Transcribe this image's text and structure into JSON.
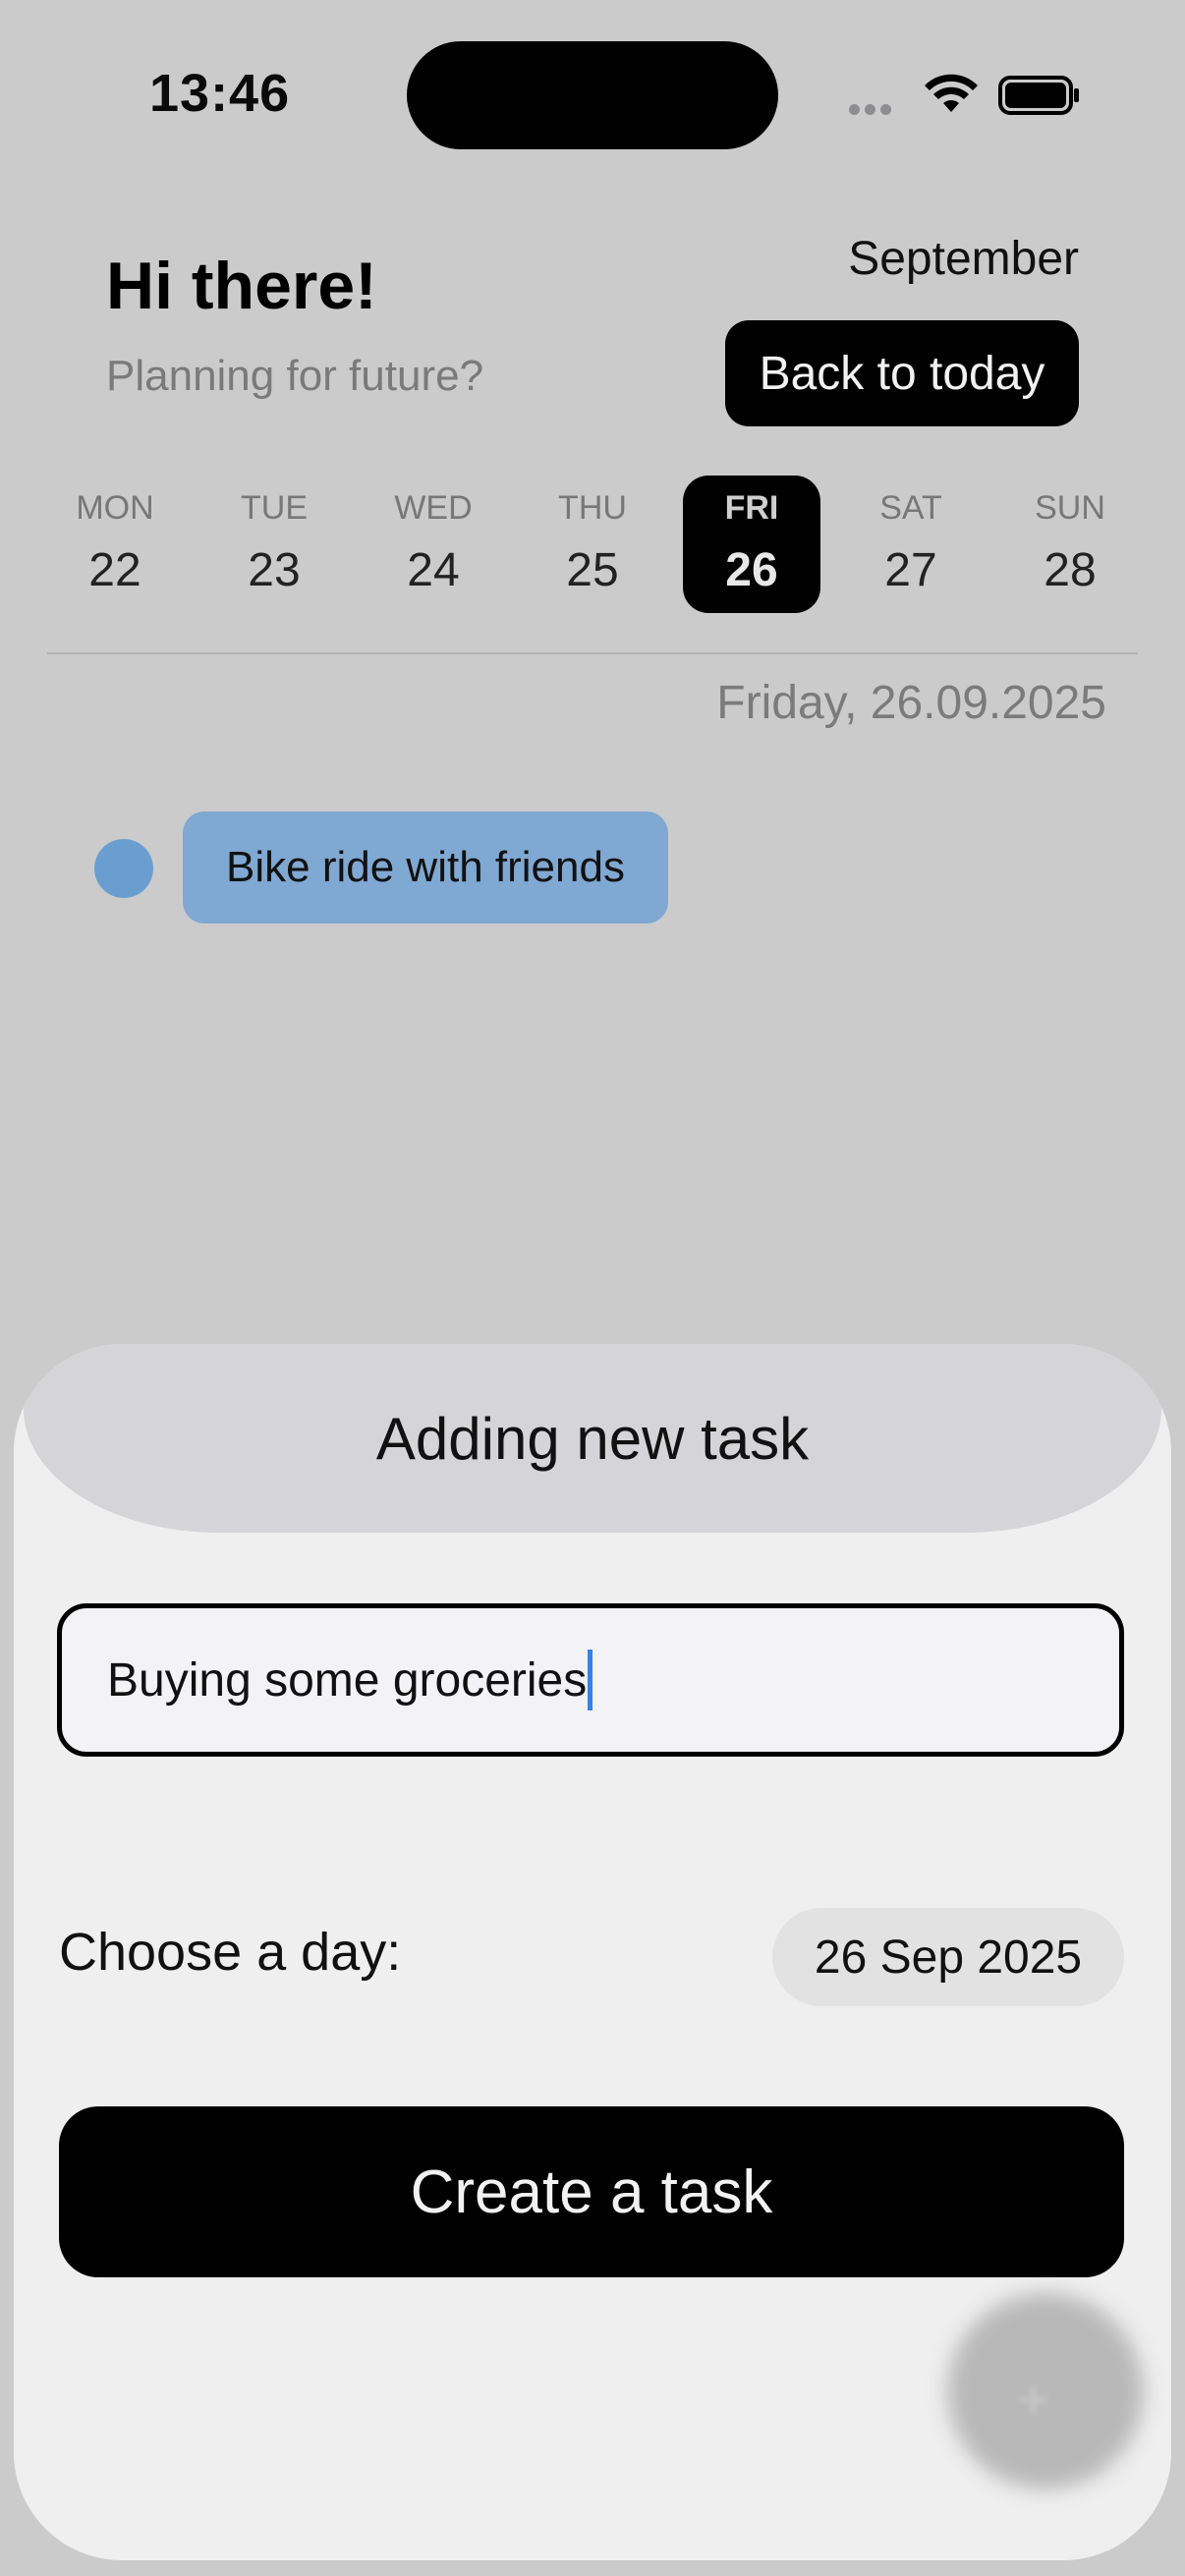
{
  "status_bar": {
    "time": "13:46"
  },
  "header": {
    "greeting": "Hi there!",
    "subtitle": "Planning for future?",
    "month": "September",
    "back_button": "Back to today"
  },
  "week": [
    {
      "name": "MON",
      "date": "22",
      "selected": false
    },
    {
      "name": "TUE",
      "date": "23",
      "selected": false
    },
    {
      "name": "WED",
      "date": "24",
      "selected": false
    },
    {
      "name": "THU",
      "date": "25",
      "selected": false
    },
    {
      "name": "FRI",
      "date": "26",
      "selected": true
    },
    {
      "name": "SAT",
      "date": "27",
      "selected": false
    },
    {
      "name": "SUN",
      "date": "28",
      "selected": false
    }
  ],
  "selected_date_label": "Friday, 26.09.2025",
  "tasks": [
    {
      "title": "Bike ride with friends",
      "color": "#7fa8d2"
    }
  ],
  "sheet": {
    "title": "Adding new task",
    "task_input_value": "Buying some groceries",
    "choose_day_label": "Choose a day:",
    "date_value": "26 Sep 2025",
    "create_button": "Create a task",
    "fab_icon": "plus-icon"
  }
}
